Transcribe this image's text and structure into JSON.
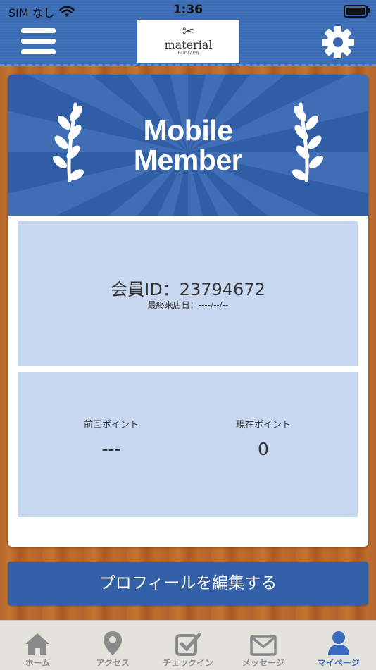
{
  "status_bar": {
    "carrier": "SIM なし",
    "time": "1:36"
  },
  "header": {
    "logo": {
      "name": "material",
      "subtitle": "hair salon"
    },
    "menu_icon": "hamburger-icon",
    "settings_icon": "gear-icon"
  },
  "banner": {
    "title_line1": "Mobile",
    "title_line2": "Member"
  },
  "member": {
    "id_label": "会員ID：23794672",
    "last_visit": "最終来店日：----/--/--"
  },
  "points": {
    "previous_label": "前回ポイント",
    "previous_value": "---",
    "current_label": "現在ポイント",
    "current_value": "0"
  },
  "edit_profile": {
    "label": "プロフィールを編集する"
  },
  "tabs": [
    {
      "label": "ホーム",
      "icon": "home-icon",
      "active": false
    },
    {
      "label": "アクセス",
      "icon": "map-pin-icon",
      "active": false
    },
    {
      "label": "チェックイン",
      "icon": "checkin-icon",
      "active": false
    },
    {
      "label": "メッセージ",
      "icon": "mail-icon",
      "active": false
    },
    {
      "label": "マイページ",
      "icon": "user-icon",
      "active": true
    }
  ],
  "colors": {
    "primary": "#3460a8",
    "panel": "#c8d8f1",
    "tab_active": "#3a6bc0",
    "tab_inactive": "#8a8a8a"
  }
}
